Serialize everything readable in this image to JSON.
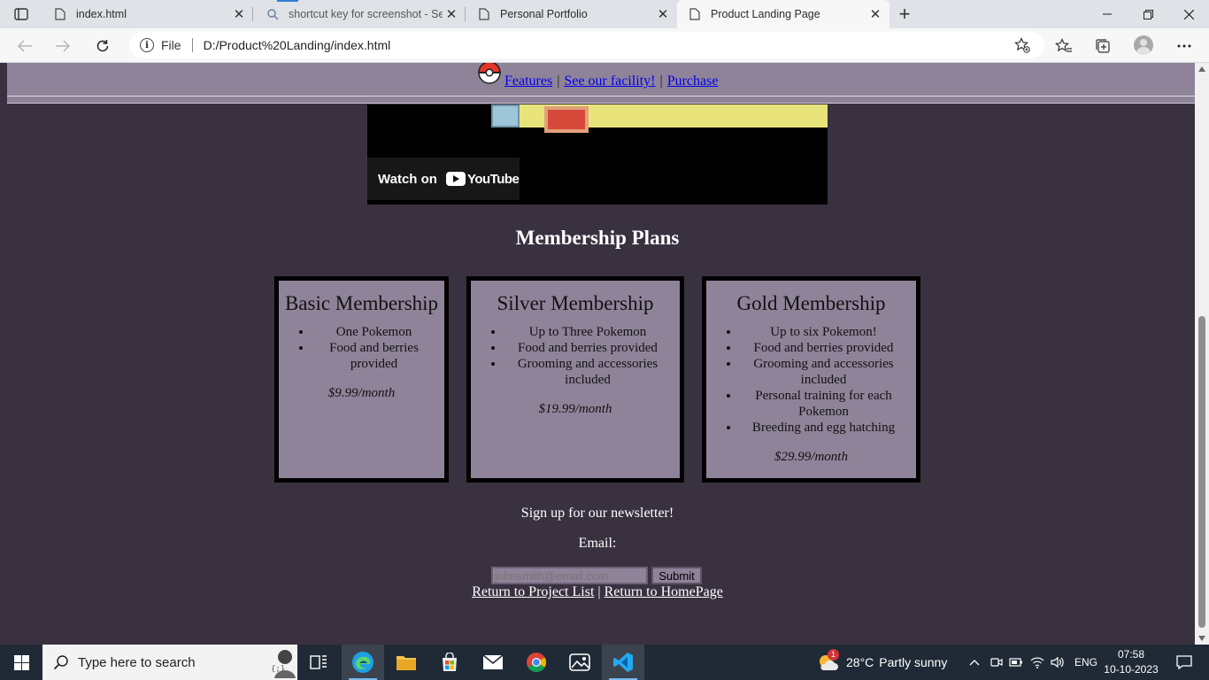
{
  "browser": {
    "tabs": [
      {
        "title": "index.html",
        "active": false
      },
      {
        "title": "shortcut key for screenshot - Sea",
        "active": false
      },
      {
        "title": "Personal Portfolio",
        "active": false
      },
      {
        "title": "Product Landing Page",
        "active": true
      }
    ],
    "address": {
      "scheme_label": "File",
      "url": "D:/Product%20Landing/index.html"
    }
  },
  "site": {
    "nav": {
      "features": "Features",
      "separator": "|",
      "facility": "See our facility!",
      "purchase": "Purchase"
    },
    "video": {
      "watch_on": "Watch on",
      "youtube": "YouTube"
    },
    "plans_title": "Membership Plans",
    "plans": [
      {
        "name": "Basic Membership",
        "features": [
          "One Pokemon",
          "Food and berries provided"
        ],
        "price": "$9.99/month"
      },
      {
        "name": "Silver Membership",
        "features": [
          "Up to Three Pokemon",
          "Food and berries provided",
          "Grooming and accessories included"
        ],
        "price": "$19.99/month"
      },
      {
        "name": "Gold Membership",
        "features": [
          "Up to six Pokemon!",
          "Food and berries provided",
          "Grooming and accessories included",
          "Personal training for each Pokemon",
          "Breeding and egg hatching"
        ],
        "price": "$29.99/month"
      }
    ],
    "newsletter": {
      "heading": "Sign up for our newsletter!",
      "email_label": "Email:",
      "email_placeholder": "johnsmith@email.com",
      "submit_label": "Submit"
    },
    "footer": {
      "project_list": "Return to Project List",
      "separator": "|",
      "homepage": "Return to HomePage"
    }
  },
  "taskbar": {
    "search_placeholder": "Type here to search",
    "weather": {
      "temp": "28°C",
      "condition": "Partly sunny",
      "badge": "1"
    },
    "language": "ENG",
    "time": "07:58",
    "date": "10-10-2023"
  },
  "colors": {
    "page_bg": "#3a3140",
    "panel_bg": "#8f8399",
    "link": "#0000ee",
    "taskbar": "#202a36"
  }
}
